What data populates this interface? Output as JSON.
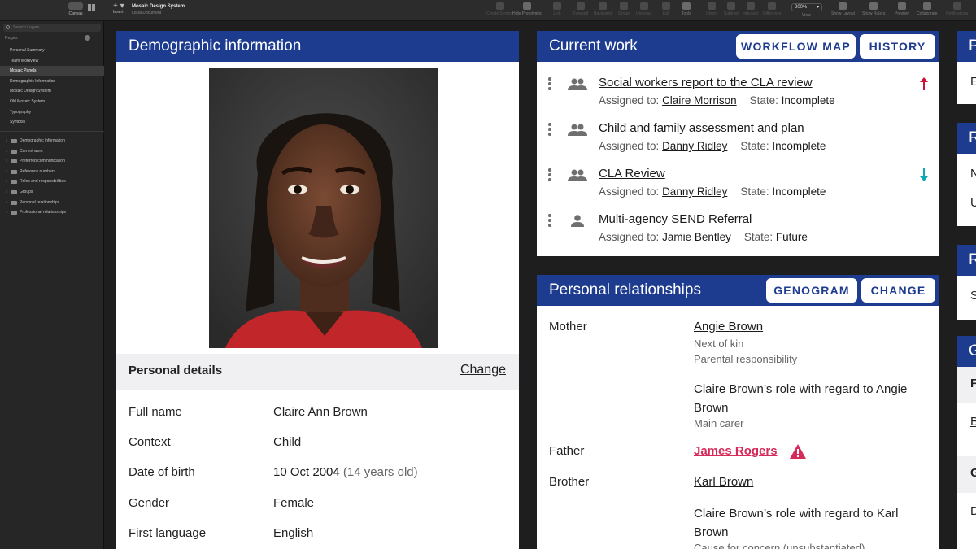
{
  "toolbar": {
    "canvas_label": "Canvas",
    "insert_label": "Insert",
    "doc_title": "Mosaic Design System",
    "doc_subtitle": "Local Document",
    "items": [
      {
        "label": "Create Symbol",
        "dim": true
      },
      {
        "label": "Hide Prototyping",
        "dim": false
      },
      {
        "label": "Link",
        "dim": true
      },
      {
        "label": "Forward",
        "dim": true
      },
      {
        "label": "Backward",
        "dim": true
      },
      {
        "label": "Group",
        "dim": true
      },
      {
        "label": "Ungroup",
        "dim": true
      },
      {
        "label": "Edit",
        "dim": true
      },
      {
        "label": "Tools",
        "dim": false
      },
      {
        "label": "Union",
        "dim": true
      },
      {
        "label": "Subtract",
        "dim": true
      },
      {
        "label": "Intersect",
        "dim": true
      },
      {
        "label": "Difference",
        "dim": true
      },
      {
        "label": "Show Layout",
        "dim": false
      },
      {
        "label": "Show Rulers",
        "dim": false
      },
      {
        "label": "Preview",
        "dim": false
      },
      {
        "label": "Collaborate",
        "dim": false
      },
      {
        "label": "Notifications",
        "dim": true
      }
    ],
    "zoom_value": "200%",
    "zoom_label": "View"
  },
  "sidebar": {
    "search_placeholder": "Search Layers",
    "pages_heading": "Pages",
    "pages": [
      {
        "label": "Personal Summary",
        "active": false
      },
      {
        "label": "Team Workview",
        "active": false
      },
      {
        "label": "Mosaic Panels",
        "active": true
      },
      {
        "label": "Demographic Information",
        "active": false
      },
      {
        "label": "Mosaic Design System",
        "active": false
      },
      {
        "label": "Old Mosaic System",
        "active": false
      },
      {
        "label": "Typography",
        "active": false
      },
      {
        "label": "Symbols",
        "active": false
      }
    ],
    "layers": [
      "Demographic information",
      "Current work",
      "Preferred communication",
      "Reference numbers",
      "Roles and responsibilities",
      "Groups",
      "Personal relationships",
      "Professional relationships"
    ]
  },
  "demographic": {
    "title": "Demographic information",
    "personal_details_heading": "Personal details",
    "change_label": "Change",
    "fields": [
      {
        "label": "Full name",
        "value": "Claire Ann Brown",
        "extra": ""
      },
      {
        "label": "Context",
        "value": "Child",
        "extra": ""
      },
      {
        "label": "Date of birth",
        "value": "10 Oct 2004",
        "extra": "(14 years old)"
      },
      {
        "label": "Gender",
        "value": "Female",
        "extra": ""
      },
      {
        "label": "First language",
        "value": "English",
        "extra": ""
      }
    ]
  },
  "current_work": {
    "title": "Current work",
    "workflow_btn": "WORKFLOW MAP",
    "history_btn": "HISTORY",
    "assigned_prefix": "Assigned to:",
    "state_prefix": "State:",
    "tasks": [
      {
        "title": "Social workers report to the CLA review",
        "assignee": "Claire Morrison",
        "state": "Incomplete",
        "icon": "people-icon",
        "arrow": "up",
        "arrow_color": "#d0103a"
      },
      {
        "title": "Child and family assessment and plan",
        "assignee": "Danny Ridley",
        "state": "Incomplete",
        "icon": "people-icon",
        "arrow": "none",
        "arrow_color": ""
      },
      {
        "title": "CLA Review",
        "assignee": "Danny Ridley",
        "state": "Incomplete",
        "icon": "people-icon",
        "arrow": "down",
        "arrow_color": "#0fa8b8"
      },
      {
        "title": "Multi-agency SEND Referral",
        "assignee": "Jamie Bentley",
        "state": "Future",
        "icon": "person-icon",
        "arrow": "none",
        "arrow_color": ""
      }
    ]
  },
  "relationships": {
    "title": "Personal relationships",
    "genogram_btn": "GENOGRAM",
    "change_btn": "CHANGE",
    "mother_label": "Mother",
    "mother_name": "Angie Brown",
    "mother_note1": "Next of kin",
    "mother_note2": "Parental responsibility",
    "mother_role_text": "Claire Brown’s role with regard to Angie Brown",
    "mother_role_note": "Main carer",
    "father_label": "Father",
    "father_name": "James Rogers",
    "brother_label": "Brother",
    "brother_name": "Karl Brown",
    "brother_role_text": "Claire Brown’s role with regard to Karl Brown",
    "brother_role_note": "Cause for concern (unsubstantiated)"
  },
  "colors": {
    "header_blue": "#1d3b8f",
    "alert_red": "#d42b5a"
  },
  "right_cards": [
    {
      "header": "P",
      "lines": [
        "E"
      ]
    },
    {
      "header": "R",
      "lines": [
        "N",
        "U"
      ]
    },
    {
      "header": "R",
      "lines": [
        "S"
      ]
    },
    {
      "header": "G",
      "lines": [
        "F",
        "B",
        "G",
        "D"
      ]
    }
  ]
}
